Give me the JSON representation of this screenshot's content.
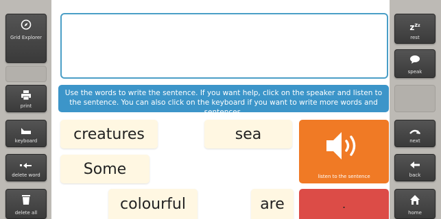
{
  "sidebar_left": [
    {
      "label": "Grid Explorer",
      "icon": "compass-icon"
    },
    {
      "label": "",
      "icon": ""
    },
    {
      "label": "print",
      "icon": "printer-icon"
    },
    {
      "label": "keyboard",
      "icon": "keyboard-icon"
    },
    {
      "label": "delete word",
      "icon": "backspace-icon"
    },
    {
      "label": "delete all",
      "icon": "trash-icon"
    }
  ],
  "sidebar_right": [
    {
      "label": "rest",
      "icon": "sleep-icon"
    },
    {
      "label": "speak",
      "icon": "speech-bubble-icon"
    },
    {
      "label": "",
      "icon": ""
    },
    {
      "label": "next",
      "icon": "next-arrow-icon"
    },
    {
      "label": "back",
      "icon": "left-arrow-icon"
    },
    {
      "label": "home",
      "icon": "home-icon"
    }
  ],
  "instruction": "Use the words to write the sentence. If you want help, click on the speaker and listen to the sentence. You can also click on the keyboard if you want to write more words and sentences.",
  "sentence_text": "",
  "words": [
    "creatures",
    "sea",
    "Some",
    "colourful",
    "are"
  ],
  "listen_button": {
    "label": "listen to the sentence"
  },
  "period_button": {
    "label": "."
  },
  "colors": {
    "accent_blue": "#3c95c9",
    "listen_orange": "#f07a25",
    "period_red": "#dc4c47",
    "word_bg": "#fff7e2"
  }
}
